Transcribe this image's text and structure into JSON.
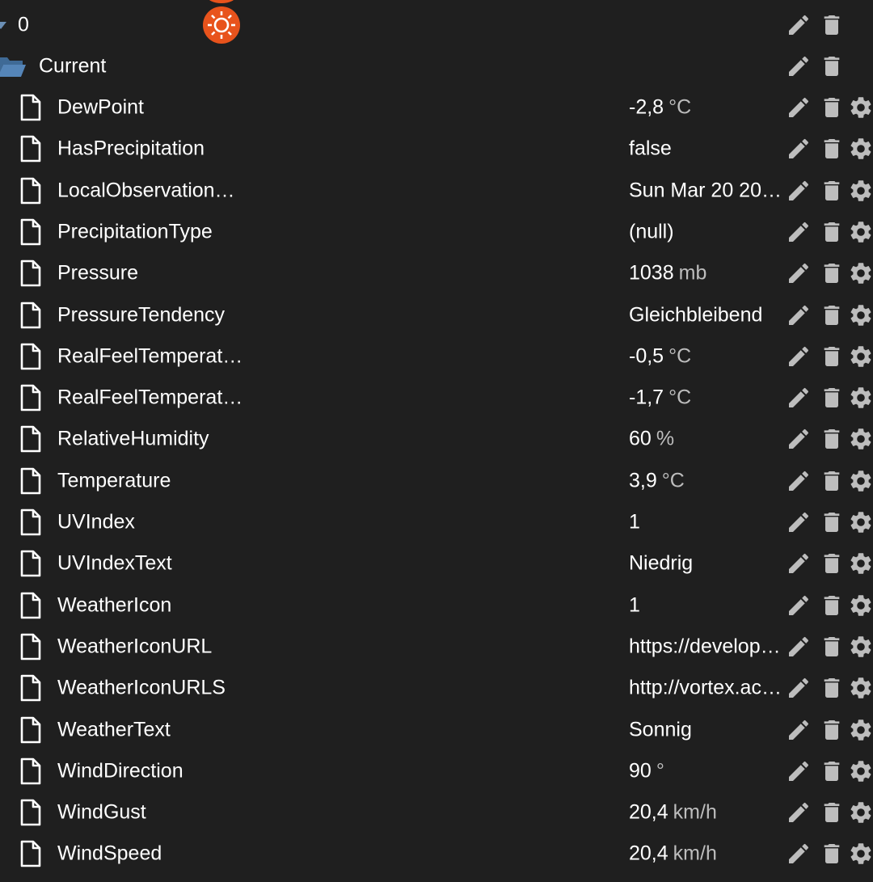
{
  "tree": {
    "index_node": {
      "label": "0",
      "icon": "sun-icon"
    },
    "folder_node": {
      "label": "Current",
      "icon": "folder-open-icon"
    },
    "actions": {
      "edit": "pencil-icon",
      "delete": "trash-icon",
      "settings": "gear-icon"
    },
    "states": [
      {
        "name": "DewPoint",
        "value": "-2,8",
        "unit": "°C"
      },
      {
        "name": "HasPrecipitation",
        "value": "false",
        "unit": ""
      },
      {
        "name": "LocalObservation…",
        "value": "Sun Mar 20 20…",
        "unit": ""
      },
      {
        "name": "PrecipitationType",
        "value": "(null)",
        "unit": ""
      },
      {
        "name": "Pressure",
        "value": "1038",
        "unit": "mb"
      },
      {
        "name": "PressureTendency",
        "value": "Gleichbleibend",
        "unit": ""
      },
      {
        "name": "RealFeelTemperat…",
        "value": "-0,5",
        "unit": "°C"
      },
      {
        "name": "RealFeelTemperat…",
        "value": "-1,7",
        "unit": "°C"
      },
      {
        "name": "RelativeHumidity",
        "value": "60",
        "unit": "%"
      },
      {
        "name": "Temperature",
        "value": "3,9",
        "unit": "°C"
      },
      {
        "name": "UVIndex",
        "value": "1",
        "unit": ""
      },
      {
        "name": "UVIndexText",
        "value": "Niedrig",
        "unit": ""
      },
      {
        "name": "WeatherIcon",
        "value": "1",
        "unit": ""
      },
      {
        "name": "WeatherIconURL",
        "value": "https://develop…",
        "unit": ""
      },
      {
        "name": "WeatherIconURLS",
        "value": "http://vortex.ac…",
        "unit": ""
      },
      {
        "name": "WeatherText",
        "value": "Sonnig",
        "unit": ""
      },
      {
        "name": "WindDirection",
        "value": "90",
        "unit": "°"
      },
      {
        "name": "WindGust",
        "value": "20,4",
        "unit": "km/h"
      },
      {
        "name": "WindSpeed",
        "value": "20,4",
        "unit": "km/h"
      }
    ]
  },
  "colors": {
    "background": "#1f1f1f",
    "text": "#ffffff",
    "unit_text": "#bdbdbd",
    "icon_gray": "#bdbdbd",
    "folder_blue": "#4a78a8",
    "sun_orange": "#e8531c"
  }
}
